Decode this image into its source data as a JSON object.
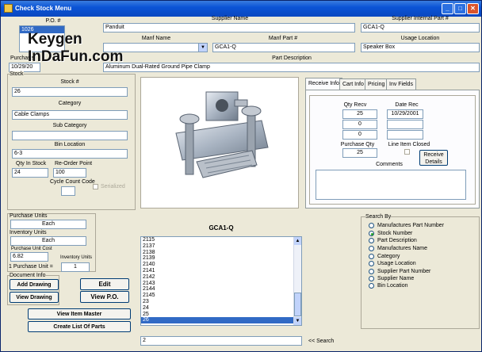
{
  "window": {
    "title": "Check Stock Menu"
  },
  "po": {
    "label": "P.O. #",
    "selected": "1026"
  },
  "purchase_date": {
    "label": "Purchase",
    "value": "10/29/20"
  },
  "stock": {
    "label": "Stock",
    "stock_number_label": "Stock #",
    "stock_number": "26",
    "category_label": "Category",
    "category": "Cable Clamps",
    "subcategory_label": "Sub Category",
    "subcategory": "",
    "bin_label": "Bin Location",
    "bin": "6-3",
    "qty_label": "Qty In Stock",
    "qty": "24",
    "reorder_label": "Re-Order Point",
    "reorder": "100",
    "cycle_label": "Cycle Count Code",
    "cycle": "",
    "serialized_label": "Serialized"
  },
  "supplier": {
    "label": "Supplier Name",
    "value": "Panduit",
    "internal_label": "Supplier Internal Part #",
    "internal": "GCA1-Q"
  },
  "manufacturer": {
    "name_label": "Manf Name",
    "name": "",
    "part_label": "Manf Part #",
    "part": "GCA1-Q",
    "usage_label": "Usage Location",
    "usage": "Speaker Box"
  },
  "description": {
    "label": "Part Description",
    "value": "Aluminum Dual-Rated Ground Pipe Clamp"
  },
  "tabs": [
    "Receive Info",
    "Cart Info",
    "Pricing",
    "Inv Fields"
  ],
  "receive": {
    "qty_recv_label": "Qty Recv",
    "date_rec_label": "Date Rec",
    "rows": [
      {
        "qty": "25",
        "date": "10/29/2001"
      },
      {
        "qty": "0",
        "date": ""
      },
      {
        "qty": "0",
        "date": ""
      }
    ],
    "purchase_qty_label": "Purchase Qty",
    "purchase_qty": "25",
    "line_item_closed_label": "Line Item Closed",
    "receive_details_button": "Receive Details",
    "comments_label": "Comments",
    "comments": ""
  },
  "units": {
    "purchase_units_label": "Purchase Units",
    "purchase_units": "Each",
    "inventory_units_label": "Inventory Units",
    "inventory_units": "Each",
    "unit_cost_label": "Purchase Unit Cost",
    "unit_cost": "6.82",
    "conversion_label": "1 Purchase Unit =",
    "inventory_units_small_label": "Inventory Units",
    "conversion": "1"
  },
  "document": {
    "label": "Document Info",
    "add_drawing": "Add Drawing",
    "view_drawing": "View Drawing"
  },
  "buttons": {
    "edit": "Edit",
    "view_po": "View P.O.",
    "view_item_master": "View Item Master",
    "create_list": "Create List Of Parts"
  },
  "part_list": {
    "title": "GCA1-Q",
    "items": [
      "2115",
      "2137",
      "2138",
      "2139",
      "2140",
      "2141",
      "2142",
      "2143",
      "2144",
      "2145",
      "23",
      "24",
      "25",
      "26"
    ],
    "selected": "26"
  },
  "search": {
    "value": "2",
    "label": "<< Search"
  },
  "search_by": {
    "label": "Search By",
    "options": [
      "Manufactures Part Number",
      "Stock Number",
      "Part Description",
      "Manufactures Name",
      "Category",
      "Usage Location",
      "Supplier Part Number",
      "Supplier Name",
      "Bin Location"
    ],
    "selected": "Stock Number"
  },
  "watermark": "Keygen InDaFun.com"
}
